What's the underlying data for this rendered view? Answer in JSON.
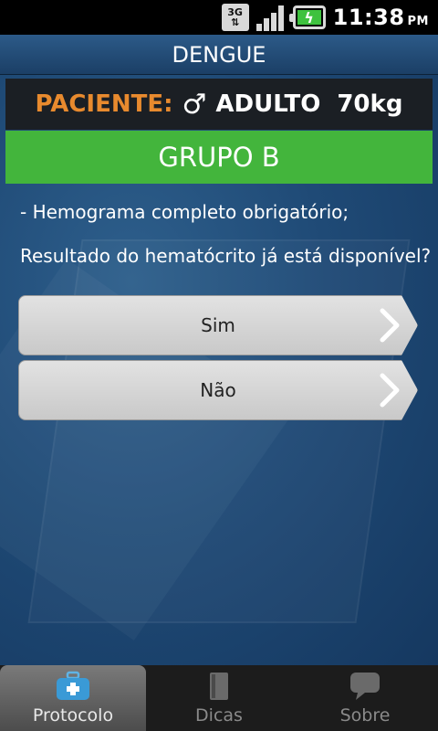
{
  "status_bar": {
    "network": "3G",
    "time": "11:38",
    "ampm": "PM"
  },
  "title": "DENGUE",
  "patient": {
    "label": "PACIENTE:",
    "sex_symbol": "♂",
    "age_group": "ADULTO",
    "weight": "70kg"
  },
  "group": "GRUPO B",
  "info": "- Hemograma completo obrigatório;",
  "question": "Resultado do hematócrito já está disponível?",
  "options": [
    {
      "label": "Sim"
    },
    {
      "label": "Não"
    }
  ],
  "tabs": [
    {
      "label": "Protocolo",
      "icon": "medical-kit-icon",
      "active": true
    },
    {
      "label": "Dicas",
      "icon": "book-icon",
      "active": false
    },
    {
      "label": "Sobre",
      "icon": "speech-bubble-icon",
      "active": false
    }
  ],
  "colors": {
    "accent_orange": "#e88a2e",
    "group_green": "#43b53c",
    "title_blue": "#2c5a88"
  }
}
